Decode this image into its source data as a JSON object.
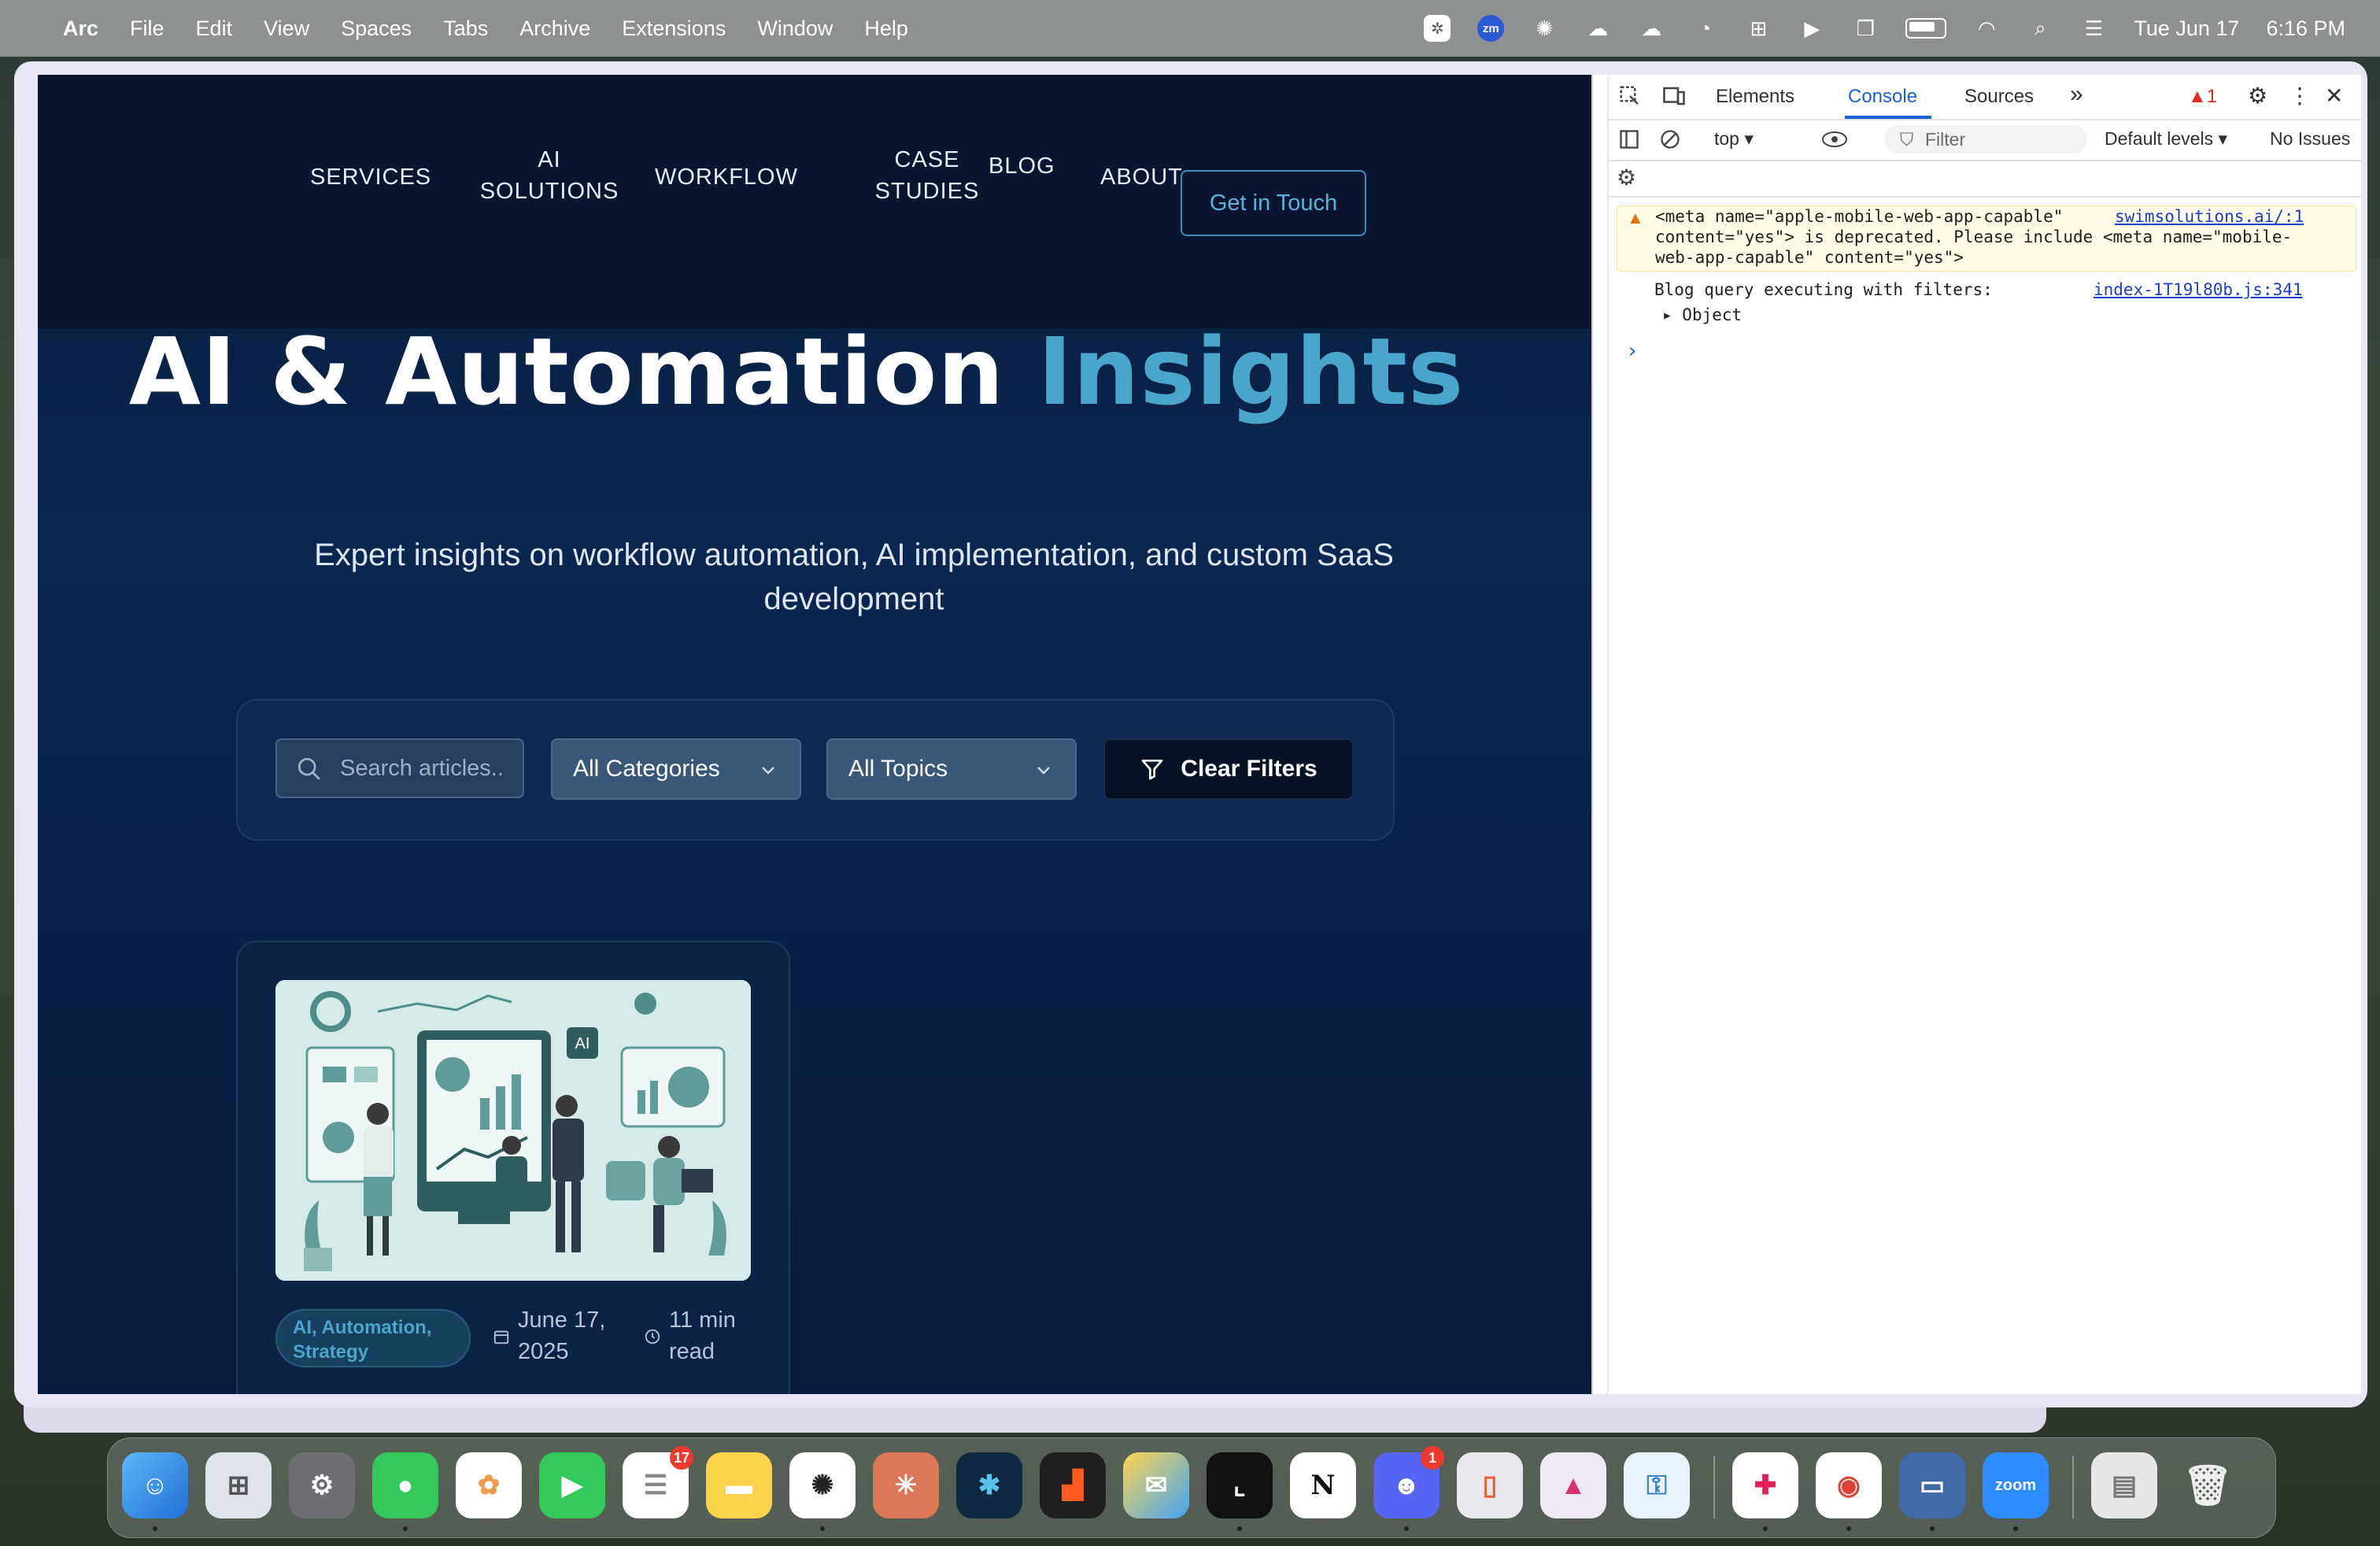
{
  "menubar": {
    "app": "Arc",
    "items": [
      "File",
      "Edit",
      "View",
      "Spaces",
      "Tabs",
      "Archive",
      "Extensions",
      "Window",
      "Help"
    ],
    "date": "Tue Jun 17",
    "time": "6:16 PM",
    "zoom_label": "zm"
  },
  "site": {
    "nav": {
      "services": "SERVICES",
      "ai_solutions_1": "AI",
      "ai_solutions_2": "SOLUTIONS",
      "workflow": "WORKFLOW",
      "case_studies_1": "CASE",
      "case_studies_2": "STUDIES",
      "blog": "BLOG",
      "about": "ABOUT",
      "cta": "Get in Touch"
    },
    "hero": {
      "title_main": "AI & Automation",
      "title_accent": "Insights",
      "subtitle_line1": "Expert insights on workflow automation, AI implementation, and custom SaaS",
      "subtitle_line2": "development"
    },
    "filters": {
      "search_placeholder": "Search articles..",
      "categories": "All Categories",
      "topics": "All Topics",
      "clear": "Clear Filters"
    },
    "card": {
      "tag_line1": "AI, Automation,",
      "tag_line2": "Strategy",
      "date_line1": "June 17,",
      "date_line2": "2025",
      "read_line1": "11 min",
      "read_line2": "read",
      "chip_label": "AI"
    }
  },
  "devtools": {
    "tabs": [
      "Elements",
      "Console",
      "Sources"
    ],
    "active_tab": "Console",
    "more": "»",
    "warning_count": "1",
    "context": "top",
    "filter_placeholder": "Filter",
    "levels": "Default levels",
    "issues": "No Issues",
    "messages": {
      "warn_line1": "<meta name=\"apple-mobile-web-app-capable\"",
      "warn_line2": "content=\"yes\"> is deprecated. Please include <meta name=\"mobile-",
      "warn_line3": "web-app-capable\" content=\"yes\">",
      "warn_source": "swimsolutions.ai/:1",
      "log_line1": "Blog query executing with filters:",
      "log_source": "index-1T19l80b.js:341",
      "log_object": "Object",
      "prompt": "›"
    }
  },
  "dock": {
    "reminders_badge": "17",
    "discord_badge": "1",
    "zoom_label": "zoom",
    "notion_label": "N"
  },
  "colors": {
    "accent": "#4aa5cc",
    "site_bg": "#0b2650",
    "devtools_active": "#1a5fd6"
  }
}
